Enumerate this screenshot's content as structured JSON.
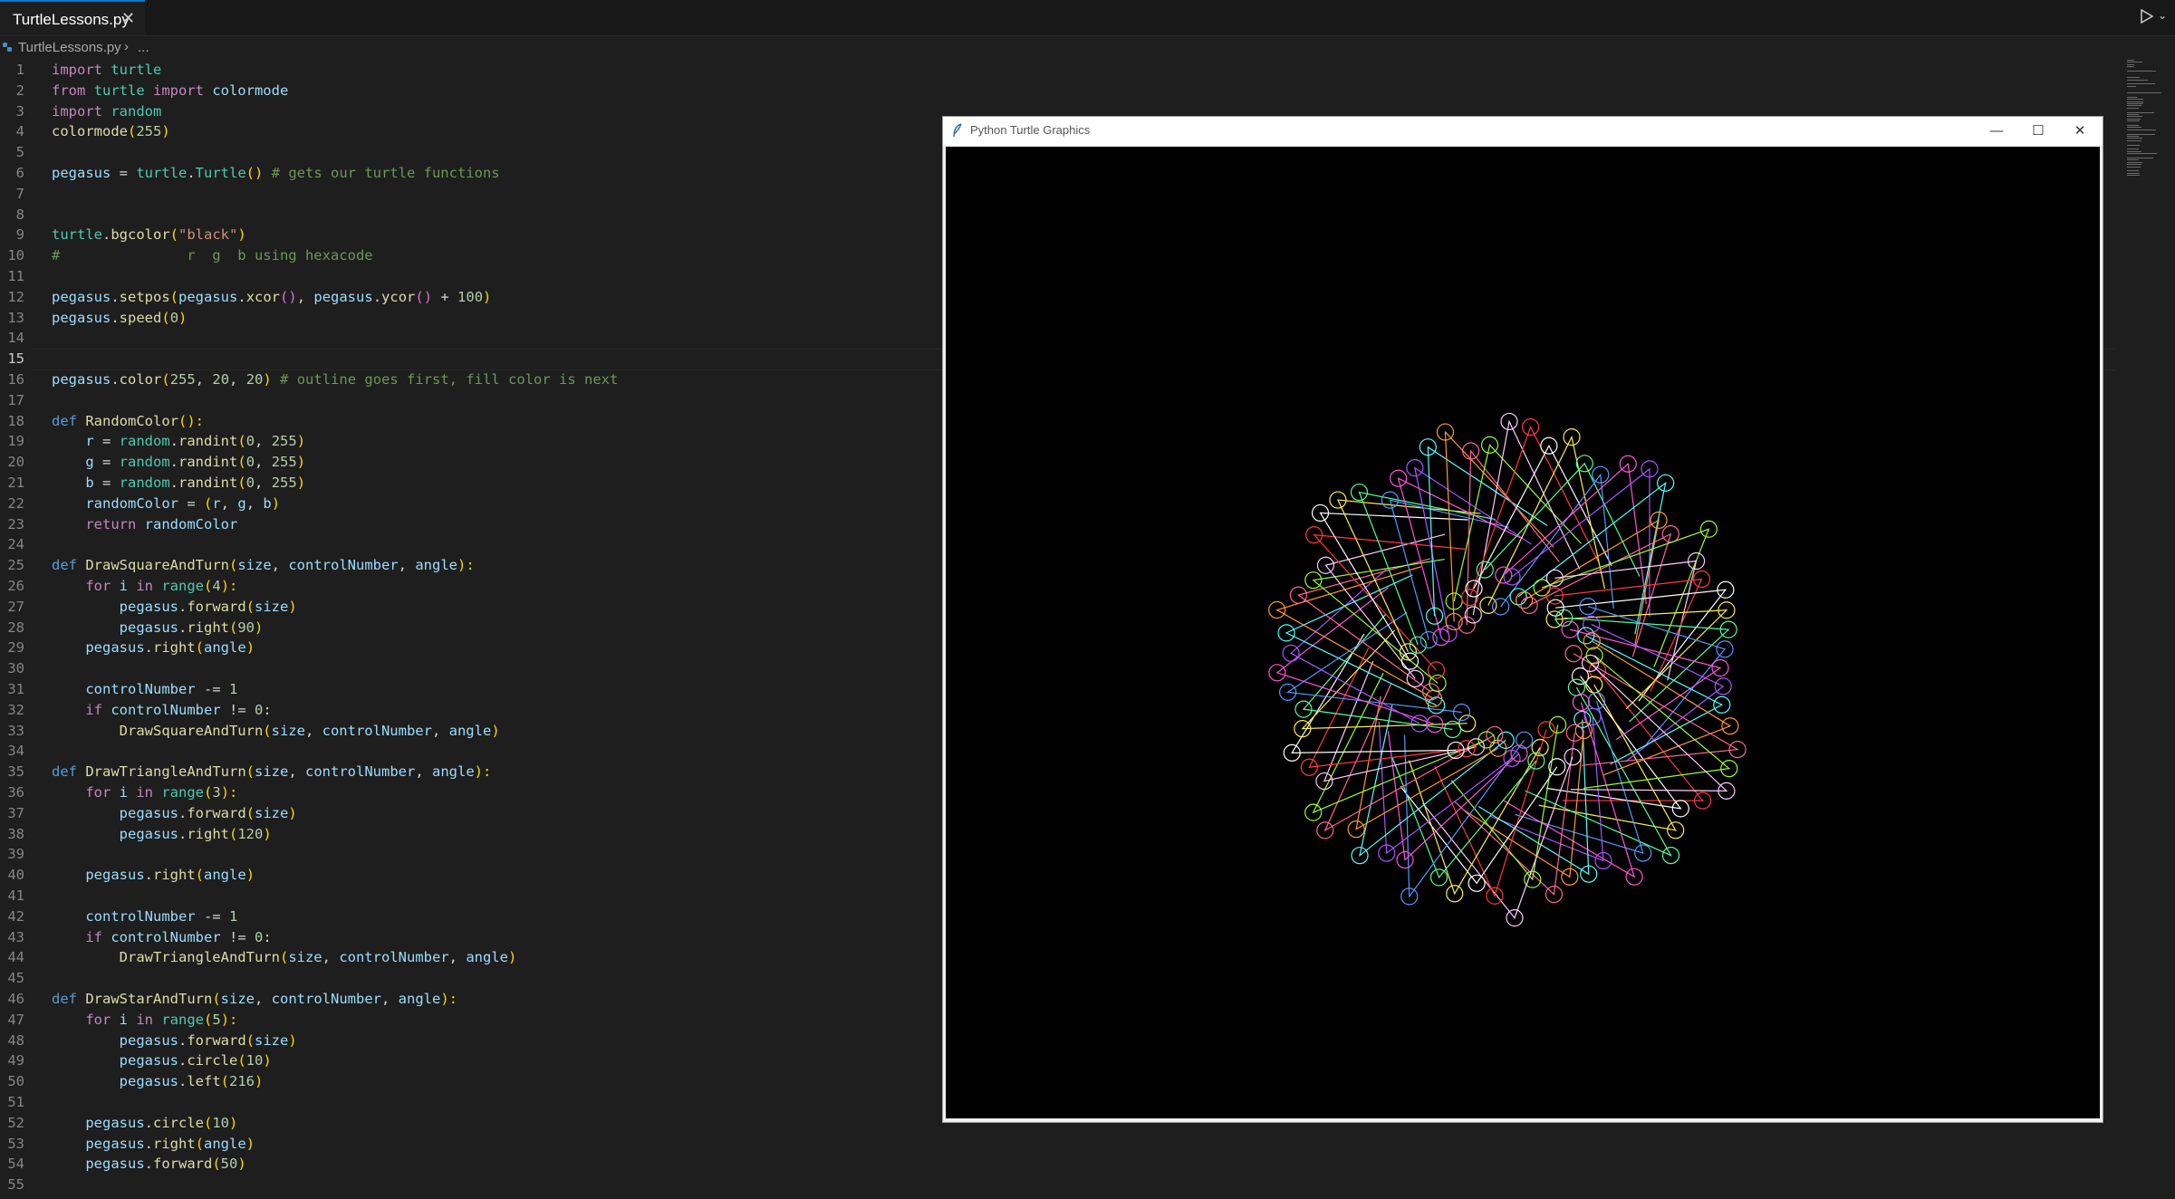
{
  "tabs": [
    {
      "label": "TurtleLessons.py",
      "close_glyph": "✕"
    }
  ],
  "breadcrumb": {
    "file": "TurtleLessons.py",
    "separator": "›",
    "more": "..."
  },
  "run_button": {
    "icon": "play-icon",
    "dropdown_icon": "chevron-down-icon"
  },
  "editor": {
    "active_line": 15,
    "lines": [
      [
        {
          "t": "import",
          "c": "kw"
        },
        {
          "t": " turtle",
          "c": "mod"
        }
      ],
      [
        {
          "t": "from",
          "c": "kw"
        },
        {
          "t": " turtle ",
          "c": "mod"
        },
        {
          "t": "import",
          "c": "kw"
        },
        {
          "t": " colormode",
          "c": "var"
        }
      ],
      [
        {
          "t": "import",
          "c": "kw"
        },
        {
          "t": " random",
          "c": "mod"
        }
      ],
      [
        {
          "t": "colormode",
          "c": "fn"
        },
        {
          "t": "(",
          "c": "p1"
        },
        {
          "t": "255",
          "c": "num"
        },
        {
          "t": ")",
          "c": "p1"
        }
      ],
      [],
      [
        {
          "t": "pegasus",
          "c": "var"
        },
        {
          "t": " = ",
          "c": ""
        },
        {
          "t": "turtle",
          "c": "mod"
        },
        {
          "t": ".",
          "c": ""
        },
        {
          "t": "Turtle",
          "c": "mod"
        },
        {
          "t": "()",
          "c": "p1"
        },
        {
          "t": " # gets our turtle functions",
          "c": "cm"
        }
      ],
      [],
      [],
      [
        {
          "t": "turtle",
          "c": "mod"
        },
        {
          "t": ".",
          "c": ""
        },
        {
          "t": "bgcolor",
          "c": "fn"
        },
        {
          "t": "(",
          "c": "p1"
        },
        {
          "t": "\"black\"",
          "c": "str"
        },
        {
          "t": ")",
          "c": "p1"
        }
      ],
      [
        {
          "t": "#               r  g  b using hexacode",
          "c": "cm"
        }
      ],
      [],
      [
        {
          "t": "pegasus",
          "c": "var"
        },
        {
          "t": ".",
          "c": ""
        },
        {
          "t": "setpos",
          "c": "fn"
        },
        {
          "t": "(",
          "c": "p1"
        },
        {
          "t": "pegasus",
          "c": "var"
        },
        {
          "t": ".",
          "c": ""
        },
        {
          "t": "xcor",
          "c": "fn"
        },
        {
          "t": "()",
          "c": "p2"
        },
        {
          "t": ", ",
          "c": ""
        },
        {
          "t": "pegasus",
          "c": "var"
        },
        {
          "t": ".",
          "c": ""
        },
        {
          "t": "ycor",
          "c": "fn"
        },
        {
          "t": "()",
          "c": "p2"
        },
        {
          "t": " + ",
          "c": ""
        },
        {
          "t": "100",
          "c": "num"
        },
        {
          "t": ")",
          "c": "p1"
        }
      ],
      [
        {
          "t": "pegasus",
          "c": "var"
        },
        {
          "t": ".",
          "c": ""
        },
        {
          "t": "speed",
          "c": "fn"
        },
        {
          "t": "(",
          "c": "p1"
        },
        {
          "t": "0",
          "c": "num"
        },
        {
          "t": ")",
          "c": "p1"
        }
      ],
      [],
      [],
      [
        {
          "t": "pegasus",
          "c": "var"
        },
        {
          "t": ".",
          "c": ""
        },
        {
          "t": "color",
          "c": "fn"
        },
        {
          "t": "(",
          "c": "p1"
        },
        {
          "t": "255",
          "c": "num"
        },
        {
          "t": ", ",
          "c": ""
        },
        {
          "t": "20",
          "c": "num"
        },
        {
          "t": ", ",
          "c": ""
        },
        {
          "t": "20",
          "c": "num"
        },
        {
          "t": ")",
          "c": "p1"
        },
        {
          "t": " # outline goes first, fill color is next",
          "c": "cm"
        }
      ],
      [],
      [
        {
          "t": "def",
          "c": "kd"
        },
        {
          "t": " ",
          "c": ""
        },
        {
          "t": "RandomColor",
          "c": "fn"
        },
        {
          "t": "():",
          "c": "p1"
        }
      ],
      [
        {
          "t": "    r",
          "c": "var"
        },
        {
          "t": " = ",
          "c": ""
        },
        {
          "t": "random",
          "c": "mod"
        },
        {
          "t": ".",
          "c": ""
        },
        {
          "t": "randint",
          "c": "fn"
        },
        {
          "t": "(",
          "c": "p1"
        },
        {
          "t": "0",
          "c": "num"
        },
        {
          "t": ", ",
          "c": ""
        },
        {
          "t": "255",
          "c": "num"
        },
        {
          "t": ")",
          "c": "p1"
        }
      ],
      [
        {
          "t": "    g",
          "c": "var"
        },
        {
          "t": " = ",
          "c": ""
        },
        {
          "t": "random",
          "c": "mod"
        },
        {
          "t": ".",
          "c": ""
        },
        {
          "t": "randint",
          "c": "fn"
        },
        {
          "t": "(",
          "c": "p1"
        },
        {
          "t": "0",
          "c": "num"
        },
        {
          "t": ", ",
          "c": ""
        },
        {
          "t": "255",
          "c": "num"
        },
        {
          "t": ")",
          "c": "p1"
        }
      ],
      [
        {
          "t": "    b",
          "c": "var"
        },
        {
          "t": " = ",
          "c": ""
        },
        {
          "t": "random",
          "c": "mod"
        },
        {
          "t": ".",
          "c": ""
        },
        {
          "t": "randint",
          "c": "fn"
        },
        {
          "t": "(",
          "c": "p1"
        },
        {
          "t": "0",
          "c": "num"
        },
        {
          "t": ", ",
          "c": ""
        },
        {
          "t": "255",
          "c": "num"
        },
        {
          "t": ")",
          "c": "p1"
        }
      ],
      [
        {
          "t": "    randomColor",
          "c": "var"
        },
        {
          "t": " = ",
          "c": ""
        },
        {
          "t": "(",
          "c": "p1"
        },
        {
          "t": "r",
          "c": "var"
        },
        {
          "t": ", ",
          "c": ""
        },
        {
          "t": "g",
          "c": "var"
        },
        {
          "t": ", ",
          "c": ""
        },
        {
          "t": "b",
          "c": "var"
        },
        {
          "t": ")",
          "c": "p1"
        }
      ],
      [
        {
          "t": "    return",
          "c": "kw"
        },
        {
          "t": " randomColor",
          "c": "var"
        }
      ],
      [],
      [
        {
          "t": "def",
          "c": "kd"
        },
        {
          "t": " ",
          "c": ""
        },
        {
          "t": "DrawSquareAndTurn",
          "c": "fn"
        },
        {
          "t": "(",
          "c": "p1"
        },
        {
          "t": "size",
          "c": "var"
        },
        {
          "t": ", ",
          "c": ""
        },
        {
          "t": "controlNumber",
          "c": "var"
        },
        {
          "t": ", ",
          "c": ""
        },
        {
          "t": "angle",
          "c": "var"
        },
        {
          "t": "):",
          "c": "p1"
        }
      ],
      [
        {
          "t": "    for",
          "c": "kw"
        },
        {
          "t": " i ",
          "c": "var"
        },
        {
          "t": "in",
          "c": "kw"
        },
        {
          "t": " range",
          "c": "mod"
        },
        {
          "t": "(",
          "c": "p1"
        },
        {
          "t": "4",
          "c": "num"
        },
        {
          "t": "):",
          "c": "p1"
        }
      ],
      [
        {
          "t": "        pegasus",
          "c": "var"
        },
        {
          "t": ".",
          "c": ""
        },
        {
          "t": "forward",
          "c": "fn"
        },
        {
          "t": "(",
          "c": "p1"
        },
        {
          "t": "size",
          "c": "var"
        },
        {
          "t": ")",
          "c": "p1"
        }
      ],
      [
        {
          "t": "        pegasus",
          "c": "var"
        },
        {
          "t": ".",
          "c": ""
        },
        {
          "t": "right",
          "c": "fn"
        },
        {
          "t": "(",
          "c": "p1"
        },
        {
          "t": "90",
          "c": "num"
        },
        {
          "t": ")",
          "c": "p1"
        }
      ],
      [
        {
          "t": "    pegasus",
          "c": "var"
        },
        {
          "t": ".",
          "c": ""
        },
        {
          "t": "right",
          "c": "fn"
        },
        {
          "t": "(",
          "c": "p1"
        },
        {
          "t": "angle",
          "c": "var"
        },
        {
          "t": ")",
          "c": "p1"
        }
      ],
      [],
      [
        {
          "t": "    controlNumber",
          "c": "var"
        },
        {
          "t": " -= ",
          "c": ""
        },
        {
          "t": "1",
          "c": "num"
        }
      ],
      [
        {
          "t": "    if",
          "c": "kw"
        },
        {
          "t": " controlNumber",
          "c": "var"
        },
        {
          "t": " != ",
          "c": ""
        },
        {
          "t": "0",
          "c": "num"
        },
        {
          "t": ":",
          "c": ""
        }
      ],
      [
        {
          "t": "        DrawSquareAndTurn",
          "c": "fn"
        },
        {
          "t": "(",
          "c": "p1"
        },
        {
          "t": "size",
          "c": "var"
        },
        {
          "t": ", ",
          "c": ""
        },
        {
          "t": "controlNumber",
          "c": "var"
        },
        {
          "t": ", ",
          "c": ""
        },
        {
          "t": "angle",
          "c": "var"
        },
        {
          "t": ")",
          "c": "p1"
        }
      ],
      [],
      [
        {
          "t": "def",
          "c": "kd"
        },
        {
          "t": " ",
          "c": ""
        },
        {
          "t": "DrawTriangleAndTurn",
          "c": "fn"
        },
        {
          "t": "(",
          "c": "p1"
        },
        {
          "t": "size",
          "c": "var"
        },
        {
          "t": ", ",
          "c": ""
        },
        {
          "t": "controlNumber",
          "c": "var"
        },
        {
          "t": ", ",
          "c": ""
        },
        {
          "t": "angle",
          "c": "var"
        },
        {
          "t": "):",
          "c": "p1"
        }
      ],
      [
        {
          "t": "    for",
          "c": "kw"
        },
        {
          "t": " i ",
          "c": "var"
        },
        {
          "t": "in",
          "c": "kw"
        },
        {
          "t": " range",
          "c": "mod"
        },
        {
          "t": "(",
          "c": "p1"
        },
        {
          "t": "3",
          "c": "num"
        },
        {
          "t": "):",
          "c": "p1"
        }
      ],
      [
        {
          "t": "        pegasus",
          "c": "var"
        },
        {
          "t": ".",
          "c": ""
        },
        {
          "t": "forward",
          "c": "fn"
        },
        {
          "t": "(",
          "c": "p1"
        },
        {
          "t": "size",
          "c": "var"
        },
        {
          "t": ")",
          "c": "p1"
        }
      ],
      [
        {
          "t": "        pegasus",
          "c": "var"
        },
        {
          "t": ".",
          "c": ""
        },
        {
          "t": "right",
          "c": "fn"
        },
        {
          "t": "(",
          "c": "p1"
        },
        {
          "t": "120",
          "c": "num"
        },
        {
          "t": ")",
          "c": "p1"
        }
      ],
      [],
      [
        {
          "t": "    pegasus",
          "c": "var"
        },
        {
          "t": ".",
          "c": ""
        },
        {
          "t": "right",
          "c": "fn"
        },
        {
          "t": "(",
          "c": "p1"
        },
        {
          "t": "angle",
          "c": "var"
        },
        {
          "t": ")",
          "c": "p1"
        }
      ],
      [],
      [
        {
          "t": "    controlNumber",
          "c": "var"
        },
        {
          "t": " -= ",
          "c": ""
        },
        {
          "t": "1",
          "c": "num"
        }
      ],
      [
        {
          "t": "    if",
          "c": "kw"
        },
        {
          "t": " controlNumber",
          "c": "var"
        },
        {
          "t": " != ",
          "c": ""
        },
        {
          "t": "0",
          "c": "num"
        },
        {
          "t": ":",
          "c": ""
        }
      ],
      [
        {
          "t": "        DrawTriangleAndTurn",
          "c": "fn"
        },
        {
          "t": "(",
          "c": "p1"
        },
        {
          "t": "size",
          "c": "var"
        },
        {
          "t": ", ",
          "c": ""
        },
        {
          "t": "controlNumber",
          "c": "var"
        },
        {
          "t": ", ",
          "c": ""
        },
        {
          "t": "angle",
          "c": "var"
        },
        {
          "t": ")",
          "c": "p1"
        }
      ],
      [],
      [
        {
          "t": "def",
          "c": "kd"
        },
        {
          "t": " ",
          "c": ""
        },
        {
          "t": "DrawStarAndTurn",
          "c": "fn"
        },
        {
          "t": "(",
          "c": "p1"
        },
        {
          "t": "size",
          "c": "var"
        },
        {
          "t": ", ",
          "c": ""
        },
        {
          "t": "controlNumber",
          "c": "var"
        },
        {
          "t": ", ",
          "c": ""
        },
        {
          "t": "angle",
          "c": "var"
        },
        {
          "t": "):",
          "c": "p1"
        }
      ],
      [
        {
          "t": "    for",
          "c": "kw"
        },
        {
          "t": " i ",
          "c": "var"
        },
        {
          "t": "in",
          "c": "kw"
        },
        {
          "t": " range",
          "c": "mod"
        },
        {
          "t": "(",
          "c": "p1"
        },
        {
          "t": "5",
          "c": "num"
        },
        {
          "t": "):",
          "c": "p1"
        }
      ],
      [
        {
          "t": "        pegasus",
          "c": "var"
        },
        {
          "t": ".",
          "c": ""
        },
        {
          "t": "forward",
          "c": "fn"
        },
        {
          "t": "(",
          "c": "p1"
        },
        {
          "t": "size",
          "c": "var"
        },
        {
          "t": ")",
          "c": "p1"
        }
      ],
      [
        {
          "t": "        pegasus",
          "c": "var"
        },
        {
          "t": ".",
          "c": ""
        },
        {
          "t": "circle",
          "c": "fn"
        },
        {
          "t": "(",
          "c": "p1"
        },
        {
          "t": "10",
          "c": "num"
        },
        {
          "t": ")",
          "c": "p1"
        }
      ],
      [
        {
          "t": "        pegasus",
          "c": "var"
        },
        {
          "t": ".",
          "c": ""
        },
        {
          "t": "left",
          "c": "fn"
        },
        {
          "t": "(",
          "c": "p1"
        },
        {
          "t": "216",
          "c": "num"
        },
        {
          "t": ")",
          "c": "p1"
        }
      ],
      [],
      [
        {
          "t": "    pegasus",
          "c": "var"
        },
        {
          "t": ".",
          "c": ""
        },
        {
          "t": "circle",
          "c": "fn"
        },
        {
          "t": "(",
          "c": "p1"
        },
        {
          "t": "10",
          "c": "num"
        },
        {
          "t": ")",
          "c": "p1"
        }
      ],
      [
        {
          "t": "    pegasus",
          "c": "var"
        },
        {
          "t": ".",
          "c": ""
        },
        {
          "t": "right",
          "c": "fn"
        },
        {
          "t": "(",
          "c": "p1"
        },
        {
          "t": "angle",
          "c": "var"
        },
        {
          "t": ")",
          "c": "p1"
        }
      ],
      [
        {
          "t": "    pegasus",
          "c": "var"
        },
        {
          "t": ".",
          "c": ""
        },
        {
          "t": "forward",
          "c": "fn"
        },
        {
          "t": "(",
          "c": "p1"
        },
        {
          "t": "50",
          "c": "num"
        },
        {
          "t": ")",
          "c": "p1"
        }
      ],
      []
    ]
  },
  "turtle_window": {
    "title": "Python Turtle Graphics",
    "controls": {
      "minimize": "—",
      "maximize": "☐",
      "close": "✕"
    },
    "canvas_background": "#000000",
    "drawing_colors": [
      "#ff3b3b",
      "#ffffff",
      "#ffee55",
      "#55ff99",
      "#5599ff",
      "#ff55dd",
      "#aa55ff",
      "#55ffff",
      "#ff9933",
      "#ff6699",
      "#99ff33",
      "#ffccff"
    ]
  },
  "colors": {
    "editor_bg": "#1e1e1e",
    "tab_accent": "#0078d4"
  }
}
